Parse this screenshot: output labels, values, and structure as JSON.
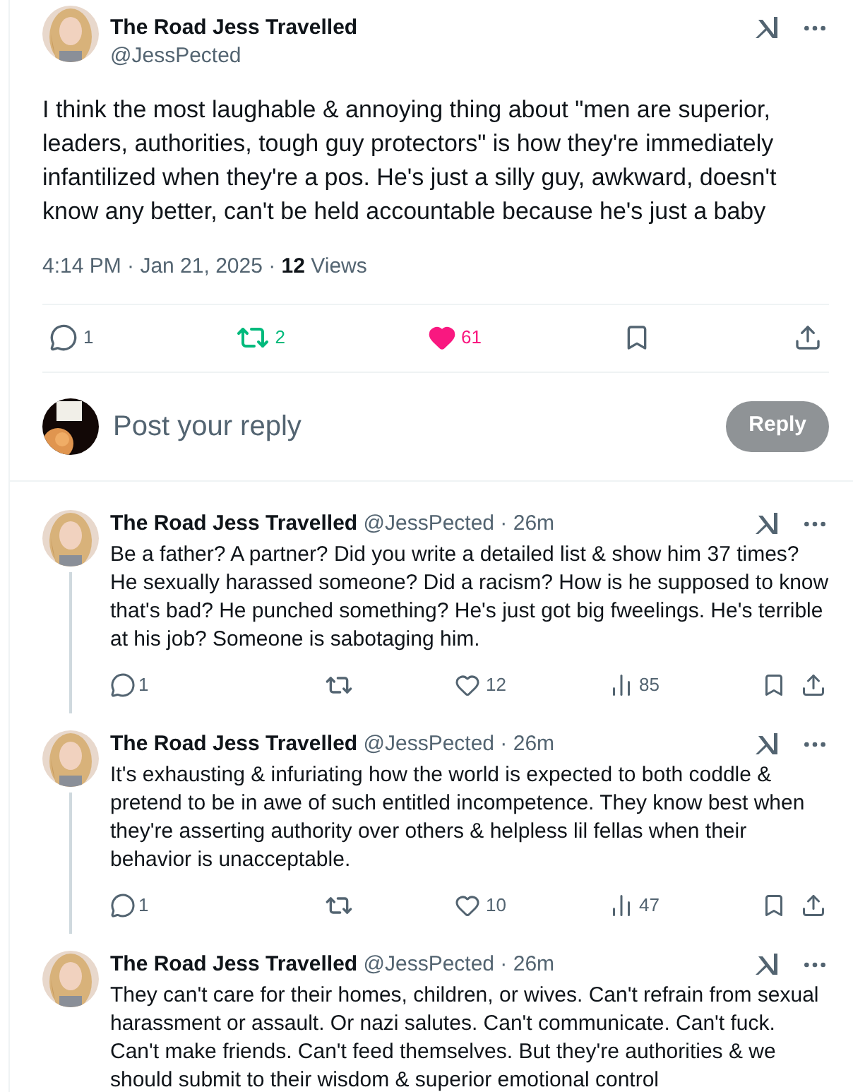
{
  "main_post": {
    "author": {
      "name": "The Road Jess Travelled",
      "handle": "@JessPected"
    },
    "text": "I think the most laughable & annoying thing about \"men are superior, leaders, authorities, tough guy protectors\" is how they're immediately infantilized when they're a pos. He's just a silly guy, awkward, doesn't know any better, can't be held accountable because he's just a baby",
    "timestamp": "4:14 PM · Jan 21, 2025 · ",
    "views_count": "12",
    "views_label": "Views",
    "actions": {
      "replies": "1",
      "reposts": "2",
      "reposted": true,
      "likes": "61",
      "liked": true
    }
  },
  "composer": {
    "placeholder": "Post your reply",
    "button": "Reply",
    "disabled": true
  },
  "replies": [
    {
      "name": "The Road Jess Travelled",
      "handle": "@JessPected · 26m",
      "text": "Be a father? A partner? Did you write a detailed list & show him 37 times? He sexually harassed someone? Did a racism? How is he supposed to know that's bad? He punched something? He's just got big fweelings. He's terrible at his job? Someone is sabotaging him.",
      "actions": {
        "replies": "1",
        "reposted": false,
        "likes": "12",
        "liked": false,
        "views": "85"
      }
    },
    {
      "name": "The Road Jess Travelled",
      "handle": "@JessPected · 26m",
      "text": "It's exhausting & infuriating how the world is expected to both coddle & pretend to be in awe of such entitled incompetence. They know best when they're asserting authority over others & helpless lil fellas when their behavior is unacceptable.",
      "actions": {
        "replies": "1",
        "reposted": false,
        "likes": "10",
        "liked": false,
        "views": "47"
      }
    },
    {
      "name": "The Road Jess Travelled",
      "handle": "@JessPected · 26m",
      "text": "They can't care for their homes, children, or wives. Can't refrain from sexual harassment or assault. Or nazi salutes. Can't communicate. Can't fuck. Can't make friends. Can't feed themselves. But they're authorities & we should submit to their wisdom & superior emotional control"
    }
  ]
}
